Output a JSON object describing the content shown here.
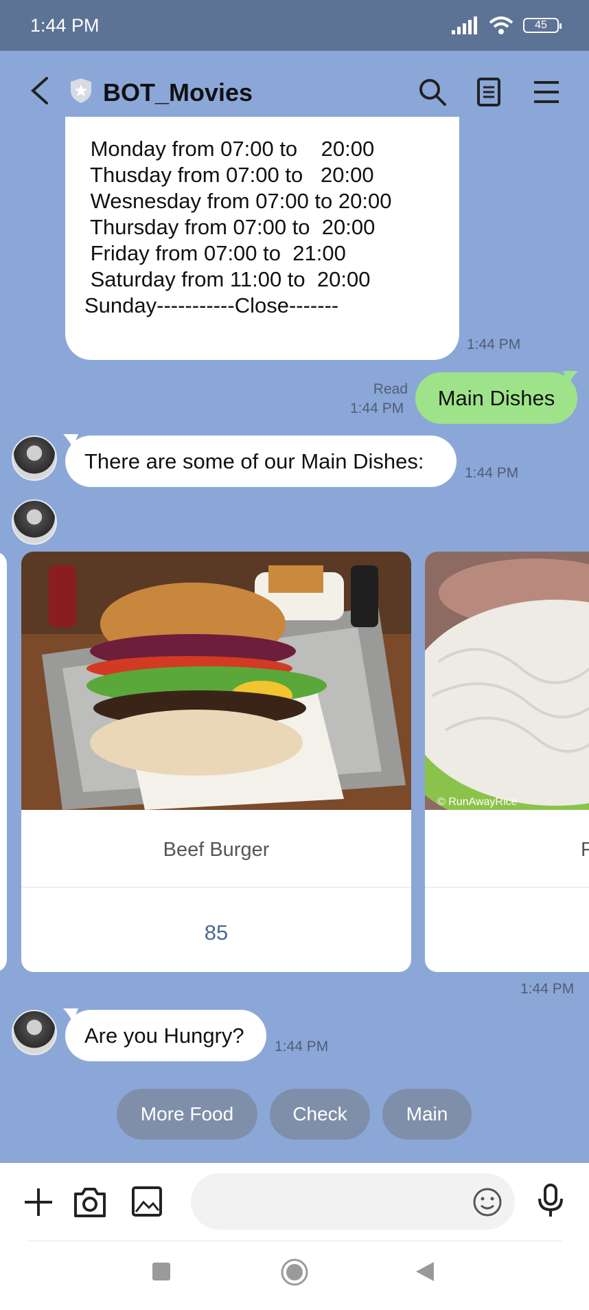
{
  "status_bar": {
    "time": "1:44 PM",
    "battery": "45"
  },
  "header": {
    "title": "BOT_Movies"
  },
  "messages": {
    "hours": {
      "lines": [
        " Monday from 07:00 to    20:00",
        " Thusday from 07:00 to   20:00",
        " Wesnesday from 07:00 to 20:00",
        " Thursday from 07:00 to  20:00",
        " Friday from 07:00 to  21:00",
        " Saturday from 11:00 to  20:00",
        "Sunday-----------Close-------"
      ],
      "time": "1:44 PM"
    },
    "sent": {
      "text": "Main Dishes",
      "read_label": "Read",
      "time": "1:44 PM"
    },
    "intro": {
      "text": "There are some of our Main Dishes:",
      "time": "1:44 PM"
    },
    "carousel": {
      "cards": [
        {
          "title": "Beef Burger",
          "price": "85"
        },
        {
          "title": "F",
          "watermark": "© RunAwayRice"
        }
      ],
      "time": "1:44 PM"
    },
    "hungry": {
      "text": "Are you Hungry?",
      "time": "1:44 PM"
    }
  },
  "quick_replies": [
    "More Food",
    "Check",
    "Main"
  ],
  "colors": {
    "chat_bg": "#8ba7d8",
    "sent_bubble": "#9ee38a",
    "quick_reply": "#7f8fa9",
    "status_bar": "#5d7395"
  }
}
